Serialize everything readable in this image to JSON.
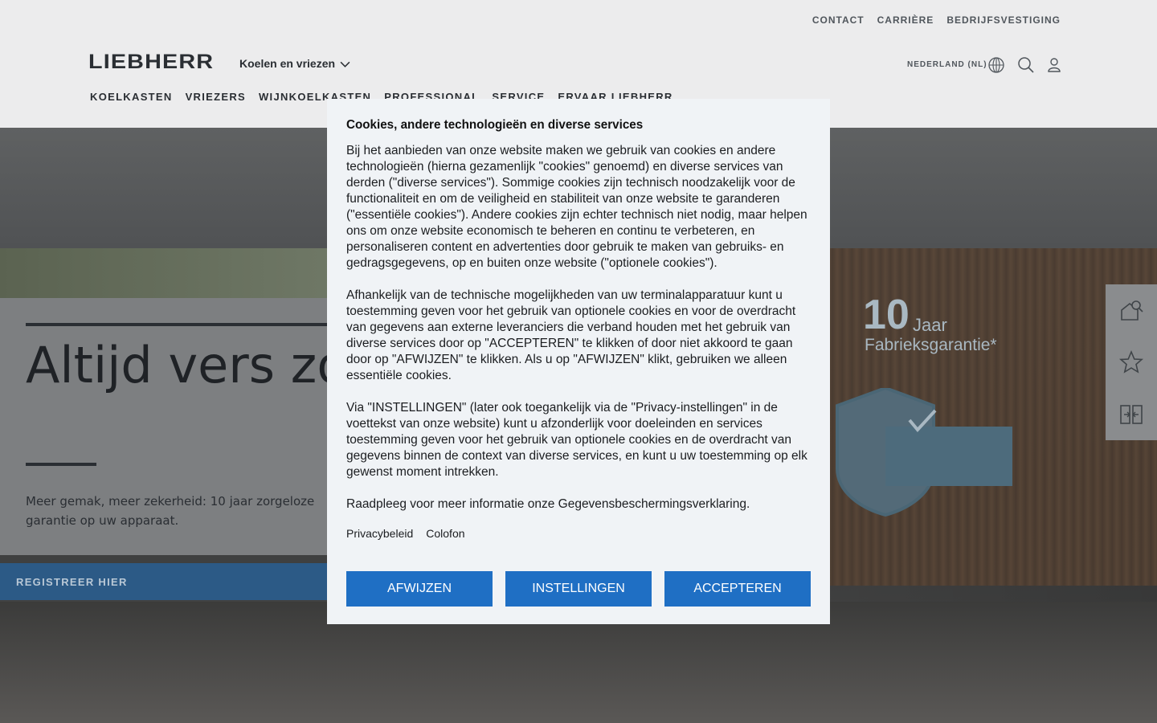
{
  "header": {
    "top_links": [
      "CONTACT",
      "CARRIÈRE",
      "BEDRIJFSVESTIGING"
    ],
    "logo": "LIEBHERR",
    "category": "Koelen en vriezen",
    "locale": "NEDERLAND (NL)",
    "nav": [
      "KOELKASTEN",
      "VRIEZERS",
      "WIJNKOELKASTEN",
      "PROFESSIONAL",
      "SERVICE",
      "ERVAAR LIEBHERR"
    ],
    "icons": [
      "globe-icon",
      "search-icon",
      "user-icon"
    ]
  },
  "hero": {
    "title": "Altijd vers zonder compromis.",
    "text": "Meer gemak, meer zekerheid: 10 jaar zorgeloze garantie op uw apparaat.",
    "button": "REGISTREER HIER",
    "badge": {
      "number": "10",
      "unit": "Jaar",
      "label": "Fabrieksgarantie*"
    }
  },
  "side_tools": [
    "house-search-icon",
    "star-icon",
    "compare-icon"
  ],
  "modal": {
    "title": "Cookies, andere technologieën en diverse services",
    "paragraphs": [
      "Bij het aanbieden van onze website maken we gebruik van cookies en andere technologieën (hierna gezamenlijk \"cookies\" genoemd) en diverse services van derden (\"diverse services\"). Sommige cookies zijn technisch noodzakelijk voor de functionaliteit en om de veiligheid en stabiliteit van onze website te garanderen (\"essentiële cookies\"). Andere cookies zijn echter technisch niet nodig, maar helpen ons om onze website economisch te beheren en continu te verbeteren, en personaliseren content en advertenties door gebruik te maken van gebruiks- en gedragsgegevens, op en buiten onze website (\"optionele cookies\").",
      "Afhankelijk van de technische mogelijkheden van uw terminalapparatuur kunt u toestemming geven voor het gebruik van optionele cookies en voor de overdracht van gegevens aan externe leveranciers die verband houden met het gebruik van diverse services door op \"ACCEPTEREN\" te klikken of door niet akkoord te gaan door op \"AFWIJZEN\" te klikken. Als u op \"AFWIJZEN\" klikt, gebruiken we alleen essentiële cookies.",
      "Via \"INSTELLINGEN\" (later ook toegankelijk via de \"Privacy-instellingen\" in de voettekst van onze website) kunt u afzonderlijk voor doeleinden en services toestemming geven voor het gebruik van optionele cookies en de overdracht van gegevens binnen de context van diverse services, en kunt u uw toestemming op elk gewenst moment intrekken.",
      "Raadpleeg voor meer informatie onze Gegevensbeschermingsverklaring."
    ],
    "links": [
      "Privacybeleid",
      "Colofon"
    ],
    "buttons": {
      "reject": "AFWIJZEN",
      "settings": "INSTELLINGEN",
      "accept": "ACCEPTEREN"
    },
    "accent_color": "#1f6fc4"
  }
}
